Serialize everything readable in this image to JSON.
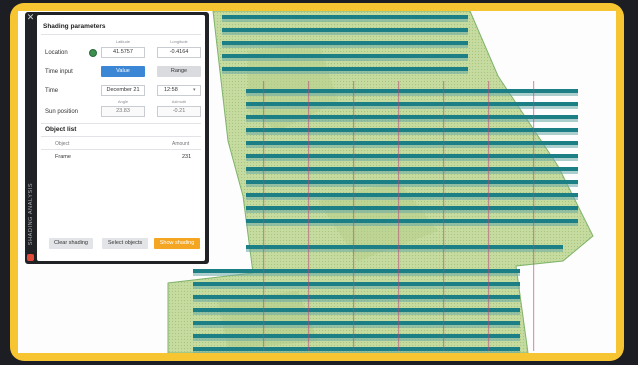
{
  "panel": {
    "side_label": "SHADING ANALYSIS",
    "close_icon": "close-icon",
    "shading_title": "Shading parameters",
    "location": {
      "label": "Location",
      "latitude_caption": "Latitude",
      "longitude_caption": "Longitude",
      "latitude": "41.5757",
      "longitude": "-0.4164"
    },
    "time_input": {
      "label": "Time input",
      "value_button": "Value",
      "range_button": "Range"
    },
    "time": {
      "label": "Time",
      "date": "December 21",
      "clock": "12:58"
    },
    "sun_position": {
      "label": "Sun position",
      "angle_caption": "Angle",
      "azimuth_caption": "Azimuth",
      "angle": "23.83",
      "azimuth": "-0.21"
    },
    "object_list": {
      "title": "Object list",
      "col_object": "Object",
      "col_amount": "Amount",
      "rows": [
        {
          "object": "Frame",
          "amount": "231"
        }
      ]
    },
    "buttons": {
      "clear": "Clear shading",
      "select": "Select objects",
      "show": "Show shading"
    }
  },
  "colors": {
    "frame": "#f7c532",
    "panel_dark": "#202226",
    "primary": "#3c86d6",
    "accent": "#f4a623",
    "site_fill": "#c4d89c",
    "panel_rows": "#1c7f86"
  }
}
